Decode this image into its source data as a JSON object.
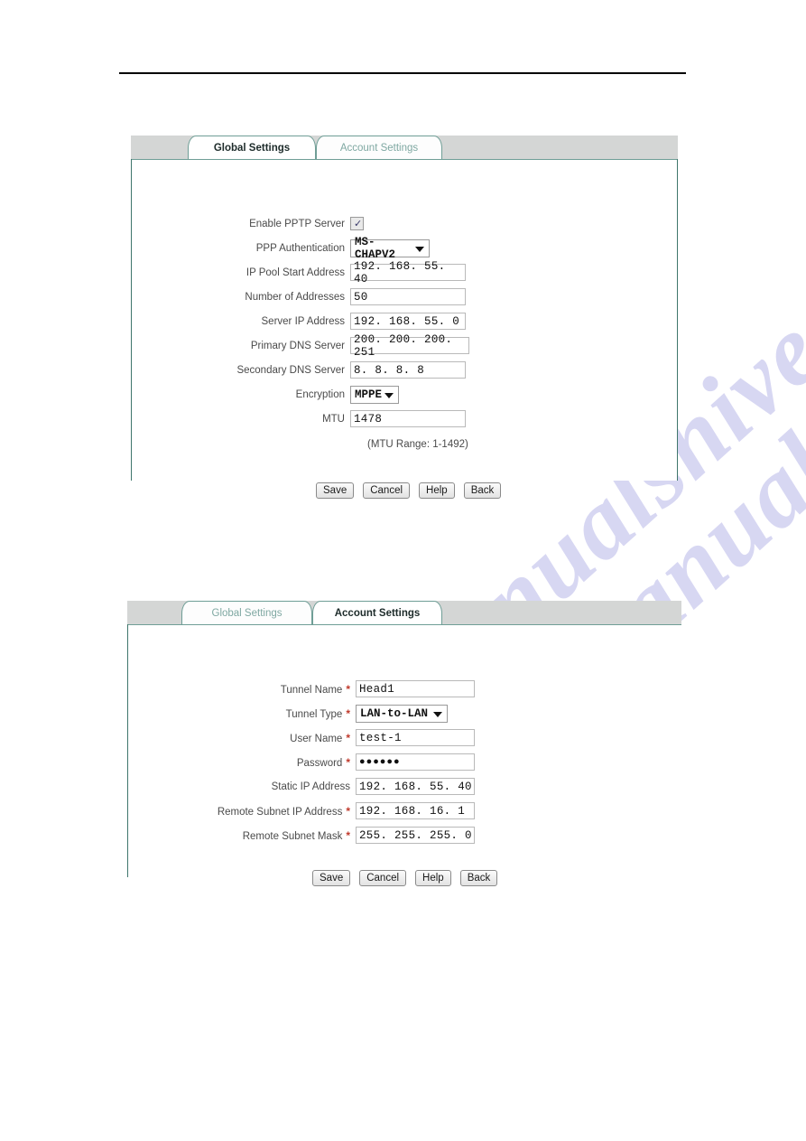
{
  "page": {
    "watermark": [
      "manualshive.com",
      "manualshive.com"
    ]
  },
  "panel1": {
    "tabs": [
      {
        "label": "Global Settings",
        "active": true
      },
      {
        "label": "Account Settings",
        "active": false
      }
    ],
    "fields": [
      {
        "label": "Enable PPTP Server",
        "type": "checkbox",
        "value": "✓",
        "required": false
      },
      {
        "label": "PPP Authentication",
        "type": "select",
        "value": "MS-CHAPV2",
        "required": false
      },
      {
        "label": "IP Pool Start Address",
        "type": "text",
        "value": "192. 168. 55. 40",
        "required": false
      },
      {
        "label": "Number of Addresses",
        "type": "text",
        "value": "50",
        "required": false
      },
      {
        "label": "Server IP Address",
        "type": "text",
        "value": "192. 168. 55. 0",
        "required": false
      },
      {
        "label": "Primary DNS Server",
        "type": "text",
        "value": "200. 200. 200. 251",
        "required": false
      },
      {
        "label": "Secondary DNS Server",
        "type": "text",
        "value": "8. 8. 8. 8",
        "required": false
      },
      {
        "label": "Encryption",
        "type": "select",
        "value": "MPPE",
        "required": false
      },
      {
        "label": "MTU",
        "type": "text",
        "value": "1478",
        "required": false
      }
    ],
    "hint": "(MTU Range: 1-1492)",
    "buttons": [
      "Save",
      "Cancel",
      "Help",
      "Back"
    ]
  },
  "panel2": {
    "tabs": [
      {
        "label": "Global Settings",
        "active": false
      },
      {
        "label": "Account Settings",
        "active": true
      }
    ],
    "fields": [
      {
        "label": "Tunnel Name",
        "type": "text",
        "value": "Head1",
        "required": true
      },
      {
        "label": "Tunnel Type",
        "type": "select",
        "value": "LAN-to-LAN",
        "required": true
      },
      {
        "label": "User Name",
        "type": "text",
        "value": "test-1",
        "required": true
      },
      {
        "label": "Password",
        "type": "password",
        "value": "●●●●●●",
        "required": true
      },
      {
        "label": "Static IP Address",
        "type": "text",
        "value": "192. 168. 55. 40",
        "required": false
      },
      {
        "label": "Remote Subnet IP Address",
        "type": "text",
        "value": "192. 168. 16. 1",
        "required": true
      },
      {
        "label": "Remote Subnet Mask",
        "type": "text",
        "value": "255. 255. 255. 0",
        "required": true
      }
    ],
    "buttons": [
      "Save",
      "Cancel",
      "Help",
      "Back"
    ]
  },
  "colors": {
    "tab_border": "#6f9e96",
    "panel_border": "#3f766c",
    "strip_grey": "#d4d6d5",
    "required_star": "#c0392b",
    "watermark": "#c9c8ee"
  }
}
